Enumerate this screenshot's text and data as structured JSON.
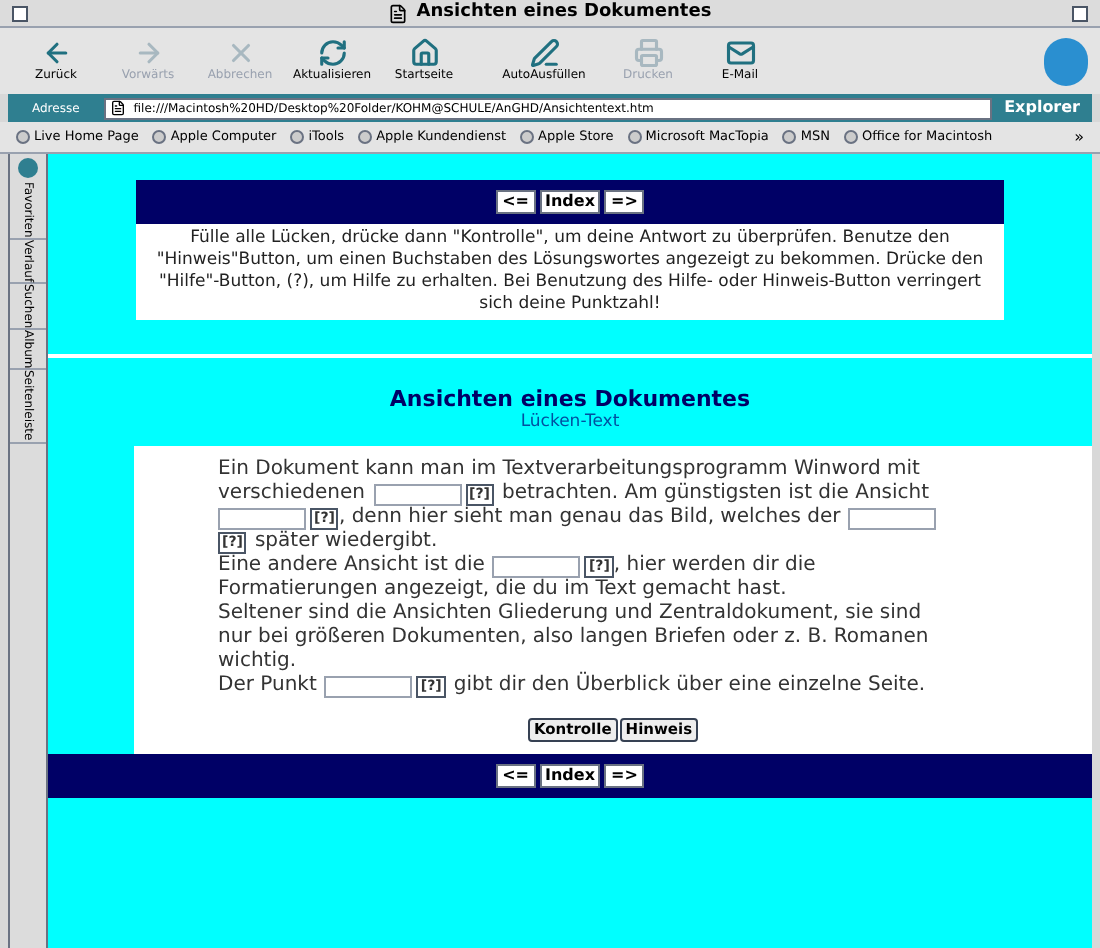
{
  "window": {
    "title": "Ansichten eines Dokumentes"
  },
  "toolbar": {
    "buttons": [
      {
        "kind": "back",
        "label": "Zurück",
        "disabled": false
      },
      {
        "kind": "forward",
        "label": "Vorwärts",
        "disabled": true
      },
      {
        "kind": "stop",
        "label": "Abbrechen",
        "disabled": true
      },
      {
        "kind": "refresh",
        "label": "Aktualisieren",
        "disabled": false
      },
      {
        "kind": "home",
        "label": "Startseite",
        "disabled": false
      },
      {
        "kind": "autofill",
        "label": "AutoAusfüllen",
        "disabled": false
      },
      {
        "kind": "print",
        "label": "Drucken",
        "disabled": true
      },
      {
        "kind": "mail",
        "label": "E-Mail",
        "disabled": false
      }
    ]
  },
  "address_bar": {
    "label": "Adresse",
    "value": "file:///Macintosh%20HD/Desktop%20Folder/KOHM@SCHULE/AnGHD/Ansichtentext.htm",
    "go": "Explorer"
  },
  "favorites_bar": {
    "items": [
      "Live Home Page",
      "Apple Computer",
      "iTools",
      "Apple Kundendienst",
      "Apple Store",
      "Microsoft MacTopia",
      "MSN",
      "Office for Macintosh"
    ],
    "more": "»"
  },
  "sidebar": {
    "tabs": [
      "Favoriten",
      "Verlauf",
      "Suchen",
      "Album",
      "Seitenleiste"
    ]
  },
  "top_frame": {
    "nav": [
      "<=",
      "Index",
      "=>"
    ],
    "instructions": "Fülle alle Lücken, drücke dann \"Kontrolle\", um deine Antwort zu überprüfen. Benutze den \"Hinweis\"Button, um einen Buchstaben des Lösungswortes angezeigt zu bekommen. Drücke den \"Hilfe\"-Button, (?), um Hilfe zu erhalten. Bei Benutzung des Hilfe- oder Hinweis-Button verringert sich deine Punktzahl!"
  },
  "exercise": {
    "title": "Ansichten eines Dokumentes",
    "subtitle": "Lücken-Text",
    "lines": [
      [
        {
          "kind": "text",
          "text": "Ein Dokument kann man im Textverarbeitungsprogramm Winword mit"
        }
      ],
      [
        {
          "kind": "text",
          "text": "verschiedenen"
        },
        {
          "kind": "field"
        },
        {
          "kind": "hint",
          "text": "[?]"
        },
        {
          "kind": "text",
          "text": "betrachten. Am günstigsten ist die Ansicht"
        }
      ],
      [
        {
          "kind": "field"
        },
        {
          "kind": "hint",
          "text": "[?]"
        },
        {
          "kind": "text",
          "text": ", denn hier sieht man genau das Bild, welches der"
        },
        {
          "kind": "field"
        }
      ],
      [
        {
          "kind": "hint",
          "text": "[?]"
        },
        {
          "kind": "text",
          "text": "später wiedergibt."
        }
      ],
      [
        {
          "kind": "text",
          "text": "Eine andere Ansicht ist die"
        },
        {
          "kind": "field"
        },
        {
          "kind": "hint",
          "text": "[?]"
        },
        {
          "kind": "text",
          "text": ", hier werden dir die"
        }
      ],
      [
        {
          "kind": "text",
          "text": "Formatierungen angezeigt, die du im Text gemacht hast."
        }
      ],
      [
        {
          "kind": "text",
          "text": "Seltener sind die Ansichten Gliederung und Zentraldokument, sie sind"
        }
      ],
      [
        {
          "kind": "text",
          "text": "nur bei größeren Dokumenten, also langen Briefen oder z. B. Romanen"
        }
      ],
      [
        {
          "kind": "text",
          "text": "wichtig."
        }
      ],
      [
        {
          "kind": "text",
          "text": "Der Punkt"
        },
        {
          "kind": "field"
        },
        {
          "kind": "hint",
          "text": "[?]"
        },
        {
          "kind": "text",
          "text": "gibt dir den Überblick über eine einzelne Seite."
        }
      ]
    ],
    "buttons": [
      "Kontrolle",
      "Hinweis"
    ],
    "nav": [
      "<=",
      "Index",
      "=>"
    ]
  }
}
